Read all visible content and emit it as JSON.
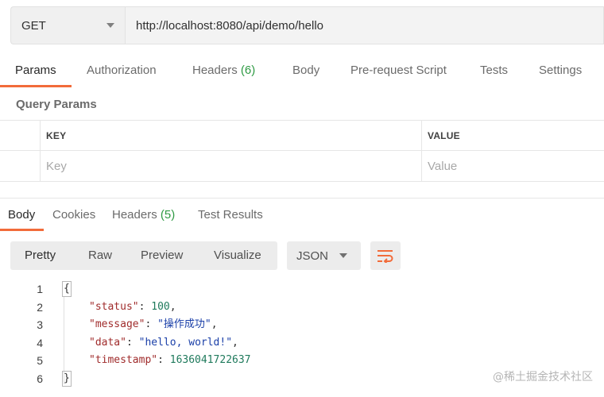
{
  "request": {
    "method": "GET",
    "url": "http://localhost:8080/api/demo/hello"
  },
  "request_tabs": [
    {
      "label": "Params",
      "active": true
    },
    {
      "label": "Authorization"
    },
    {
      "label": "Headers",
      "count": "(6)"
    },
    {
      "label": "Body"
    },
    {
      "label": "Pre-request Script"
    },
    {
      "label": "Tests"
    },
    {
      "label": "Settings"
    }
  ],
  "query_params": {
    "title": "Query Params",
    "columns": [
      "KEY",
      "VALUE"
    ],
    "key_placeholder": "Key",
    "value_placeholder": "Value"
  },
  "response_tabs": [
    {
      "label": "Body",
      "active": true
    },
    {
      "label": "Cookies"
    },
    {
      "label": "Headers",
      "count": "(5)"
    },
    {
      "label": "Test Results"
    }
  ],
  "view_modes": [
    "Pretty",
    "Raw",
    "Preview",
    "Visualize"
  ],
  "active_view": "Pretty",
  "format": "JSON",
  "code": {
    "line_numbers": [
      "1",
      "2",
      "3",
      "4",
      "5",
      "6"
    ],
    "open_brace": "{",
    "close_brace": "}",
    "fields": [
      {
        "key": "\"status\"",
        "value": "100",
        "type": "number",
        "comma": ","
      },
      {
        "key": "\"message\"",
        "value": "\"操作成功\"",
        "type": "string",
        "comma": ","
      },
      {
        "key": "\"data\"",
        "value": "\"hello, world!\"",
        "type": "string",
        "comma": ","
      },
      {
        "key": "\"timestamp\"",
        "value": "1636041722637",
        "type": "number",
        "comma": ""
      }
    ]
  },
  "watermark": "@稀土掘金技术社区",
  "colors": {
    "accent": "#f26b3a",
    "count_green": "#2e9a43",
    "json_key": "#a02c2c",
    "json_string": "#1a3fa8",
    "json_number": "#1f7a5c"
  }
}
